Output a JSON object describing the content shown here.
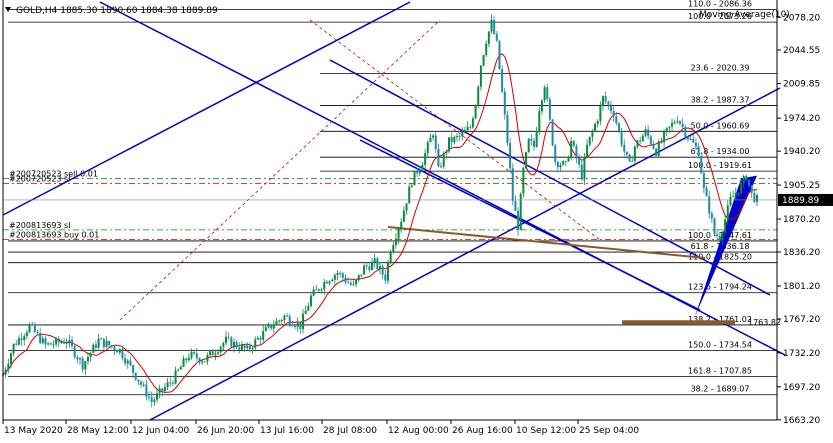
{
  "header": {
    "symbol_label": "GOLD,H4  1885.30 1890.60 1884.38 1889.89",
    "moving_average_label": "Moving Average(10)"
  },
  "colors": {
    "background": "#ffffff",
    "axis": "#000000",
    "candle_up": "#0a8a3a",
    "candle_down": "#1e88a8",
    "ma_line": "#d00000",
    "trend_lines": "#0000cc",
    "fib_lines": "#000000",
    "order_line_green": "#008000",
    "order_line_red": "#cc0000",
    "brown_line": "#8b5a2b",
    "current_price_box": "#000000"
  },
  "chart_data": {
    "type": "candlestick",
    "symbol": "GOLD",
    "timeframe": "H4",
    "ylim": [
      1663.0,
      2094.0
    ],
    "y_ticks": [
      "2078.20",
      "2044.55",
      "2009.85",
      "1974.20",
      "1940.20",
      "1905.25",
      "1870.20",
      "1836.20",
      "1801.20",
      "1767.20",
      "1732.20",
      "1697.20",
      "1663.20"
    ],
    "x_ticks": [
      "13 May 2020",
      "28 May 12:00",
      "12 Jun 04:00",
      "26 Jun 20:00",
      "13 Jul 16:00",
      "28 Jul 08:00",
      "12 Aug 00:00",
      "26 Aug 16:00",
      "10 Sep 12:00",
      "25 Sep 04:00"
    ],
    "current_price": "1889.89",
    "price_path": [
      [
        0,
        1710
      ],
      [
        2,
        1740
      ],
      [
        5,
        1760
      ],
      [
        8,
        1740
      ],
      [
        12,
        1745
      ],
      [
        15,
        1720
      ],
      [
        18,
        1745
      ],
      [
        22,
        1735
      ],
      [
        26,
        1700
      ],
      [
        28,
        1682
      ],
      [
        32,
        1705
      ],
      [
        35,
        1730
      ],
      [
        38,
        1725
      ],
      [
        42,
        1745
      ],
      [
        46,
        1735
      ],
      [
        50,
        1758
      ],
      [
        53,
        1770
      ],
      [
        56,
        1760
      ],
      [
        58,
        1790
      ],
      [
        61,
        1808
      ],
      [
        63,
        1815
      ],
      [
        66,
        1800
      ],
      [
        68,
        1820
      ],
      [
        70,
        1825
      ],
      [
        72,
        1810
      ],
      [
        73,
        1840
      ],
      [
        75,
        1870
      ],
      [
        77,
        1910
      ],
      [
        79,
        1930
      ],
      [
        81,
        1960
      ],
      [
        82,
        1920
      ],
      [
        84,
        1950
      ],
      [
        86,
        1955
      ],
      [
        88,
        1965
      ],
      [
        89,
        1990
      ],
      [
        90,
        2030
      ],
      [
        91,
        2055
      ],
      [
        92,
        2072
      ],
      [
        93,
        2050
      ],
      [
        94,
        2000
      ],
      [
        95,
        1950
      ],
      [
        96,
        1890
      ],
      [
        97,
        1863
      ],
      [
        98,
        1920
      ],
      [
        99,
        1950
      ],
      [
        100,
        1945
      ],
      [
        101,
        1985
      ],
      [
        102,
        2010
      ],
      [
        103,
        1970
      ],
      [
        104,
        1930
      ],
      [
        106,
        1925
      ],
      [
        107,
        1950
      ],
      [
        109,
        1915
      ],
      [
        110,
        1945
      ],
      [
        112,
        1975
      ],
      [
        113,
        1995
      ],
      [
        115,
        1980
      ],
      [
        117,
        1940
      ],
      [
        118,
        1925
      ],
      [
        119,
        1945
      ],
      [
        121,
        1960
      ],
      [
        123,
        1940
      ],
      [
        125,
        1960
      ],
      [
        127,
        1975
      ],
      [
        128,
        1965
      ],
      [
        129,
        1955
      ],
      [
        131,
        1940
      ],
      [
        132,
        1900
      ],
      [
        133,
        1880
      ],
      [
        134,
        1855
      ],
      [
        135,
        1852
      ],
      [
        136,
        1870
      ],
      [
        137,
        1890
      ],
      [
        139,
        1905
      ],
      [
        140,
        1915
      ],
      [
        141,
        1895
      ],
      [
        142,
        1890
      ]
    ],
    "fib_levels": [
      {
        "label": "110.0  -  2086.36",
        "value": 2086.36
      },
      {
        "label": "100.0  -  2073.26",
        "value": 2073.26
      },
      {
        "label": "23.6  -  2020.39",
        "value": 2020.39
      },
      {
        "label": "38.2  -  1987.37",
        "value": 1987.37
      },
      {
        "label": "50.0  -  1960.69",
        "value": 1960.69
      },
      {
        "label": "61.8  -  1934.00",
        "value": 1934.0
      },
      {
        "label": "100.0  -  1919.61",
        "value": 1919.61
      },
      {
        "label": "100.0  -  1847.61",
        "value": 1847.61
      },
      {
        "label": "61.8  -  1836.18",
        "value": 1836.18
      },
      {
        "label": "110.0  -  1825.20",
        "value": 1825.2
      },
      {
        "label": "123.6  -  1794.24",
        "value": 1794.24
      },
      {
        "label": "138.2  -  1761.02",
        "value": 1761.02
      },
      {
        "label": "150.0  -  1734.54",
        "value": 1734.54
      },
      {
        "label": "161.8  -  1707.85",
        "value": 1707.85
      },
      {
        "label": "38.2  -  1689.07",
        "value": 1689.07
      }
    ],
    "order_labels": [
      {
        "text": "#200720523 sell 0.01",
        "value": 1912
      },
      {
        "text": "#200720523 sl",
        "value": 1907
      },
      {
        "text": "#200813693 sl",
        "value": 1859
      },
      {
        "text": "#200813693 buy 0.01",
        "value": 1849
      }
    ],
    "price_labels_extra": [
      "1763.82"
    ]
  }
}
